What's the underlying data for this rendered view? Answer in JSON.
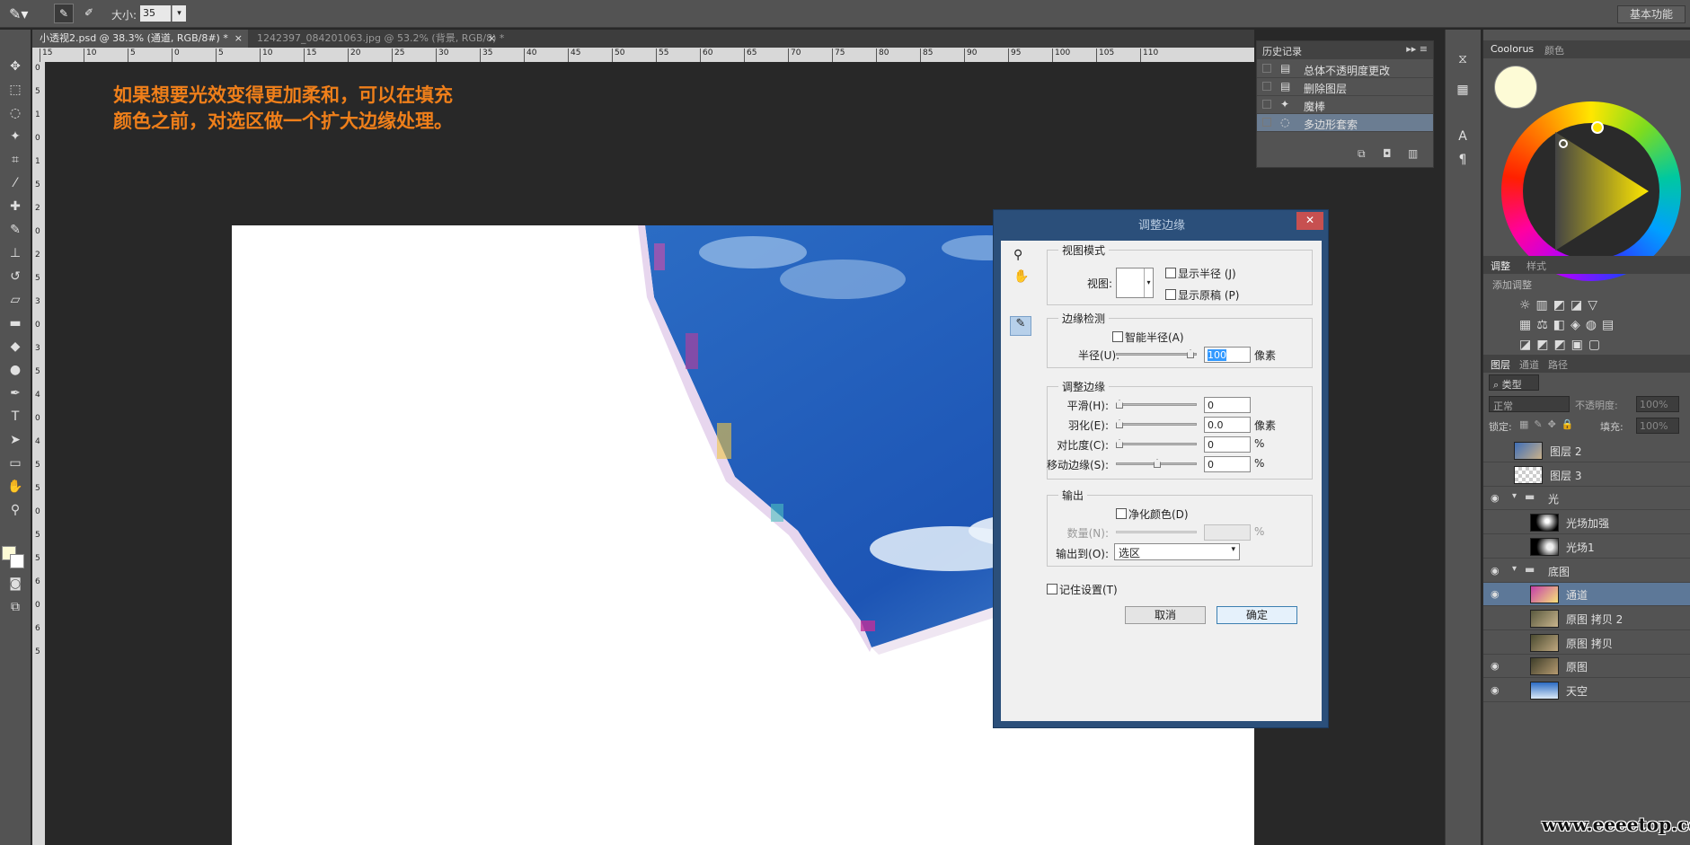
{
  "options_bar": {
    "size_label": "大小:",
    "size_value": "35",
    "workspace": "基本功能"
  },
  "tabs": [
    {
      "label": "小透视2.psd @ 38.3% (通道, RGB/8#) *"
    },
    {
      "label": "1242397_084201063.jpg @ 53.2% (背景, RGB/8) *"
    }
  ],
  "ruler_top": [
    "15",
    "10",
    "5",
    "0",
    "5",
    "10",
    "15",
    "20",
    "25",
    "30",
    "35",
    "40",
    "45",
    "50",
    "55",
    "60",
    "65",
    "70",
    "75",
    "80",
    "85",
    "90",
    "95",
    "100",
    "105",
    "110"
  ],
  "ruler_left": [
    "0",
    "5",
    "1",
    "0",
    "1",
    "5",
    "2",
    "0",
    "2",
    "5",
    "3",
    "0",
    "3",
    "5",
    "4",
    "0",
    "4",
    "5",
    "5",
    "0",
    "5",
    "5",
    "6",
    "0",
    "6",
    "5"
  ],
  "annotation": {
    "line1": "如果想要光效变得更加柔和，可以在填充",
    "line2": "颜色之前，对选区做一个扩大边缘处理。"
  },
  "history": {
    "title": "历史记录",
    "items": [
      "总体不透明度更改",
      "删除图层",
      "魔棒",
      "多边形套索"
    ]
  },
  "right_tabs": {
    "coolorus": "Coolorus",
    "color": "颜色",
    "adjust": "调整",
    "styles": "样式",
    "add_adjust": "添加调整",
    "layers": "图层",
    "channels": "通道",
    "paths": "路径"
  },
  "layers_panel": {
    "kind": "类型",
    "blend": "正常",
    "opacity_label": "不透明度:",
    "opacity": "100%",
    "lock_label": "锁定:",
    "fill_label": "填充:",
    "fill": "100%",
    "layers": [
      {
        "name": "图层 2",
        "visible": false,
        "indent": 0,
        "type": "layer"
      },
      {
        "name": "图层 3",
        "visible": false,
        "indent": 0,
        "type": "layer"
      },
      {
        "name": "光",
        "visible": true,
        "indent": 0,
        "type": "group"
      },
      {
        "name": "光场加强",
        "visible": false,
        "indent": 1,
        "type": "layer"
      },
      {
        "name": "光场1",
        "visible": false,
        "indent": 1,
        "type": "layer"
      },
      {
        "name": "底图",
        "visible": true,
        "indent": 0,
        "type": "group"
      },
      {
        "name": "通道",
        "visible": true,
        "indent": 1,
        "type": "layer",
        "selected": true
      },
      {
        "name": "原图 拷贝 2",
        "visible": false,
        "indent": 1,
        "type": "layer"
      },
      {
        "name": "原图 拷贝",
        "visible": false,
        "indent": 1,
        "type": "layer"
      },
      {
        "name": "原图",
        "visible": true,
        "indent": 1,
        "type": "layer"
      },
      {
        "name": "天空",
        "visible": true,
        "indent": 1,
        "type": "layer"
      }
    ]
  },
  "dialog": {
    "title": "调整边缘",
    "view_mode": {
      "title": "视图模式",
      "view_label": "视图:",
      "show_radius": "显示半径 (J)",
      "show_original": "显示原稿 (P)"
    },
    "edge_detection": {
      "title": "边缘检测",
      "smart_radius": "智能半径(A)",
      "radius_label": "半径(U):",
      "radius_value": "100",
      "radius_unit": "像素"
    },
    "adjust_edge": {
      "title": "调整边缘",
      "smooth_label": "平滑(H):",
      "smooth_value": "0",
      "feather_label": "羽化(E):",
      "feather_value": "0.0",
      "feather_unit": "像素",
      "contrast_label": "对比度(C):",
      "contrast_value": "0",
      "contrast_unit": "%",
      "shift_label": "移动边缘(S):",
      "shift_value": "0",
      "shift_unit": "%"
    },
    "output": {
      "title": "输出",
      "decontaminate": "净化颜色(D)",
      "amount_label": "数量(N):",
      "amount_unit": "%",
      "output_to_label": "输出到(O):",
      "output_to_value": "选区"
    },
    "remember": "记住设置(T)",
    "cancel": "取消",
    "ok": "确定"
  },
  "watermark": "www.eeeetop.com",
  "colors": {
    "accent": "#ef7f1a",
    "panel": "#535353",
    "selected_layer": "#5d7898"
  }
}
